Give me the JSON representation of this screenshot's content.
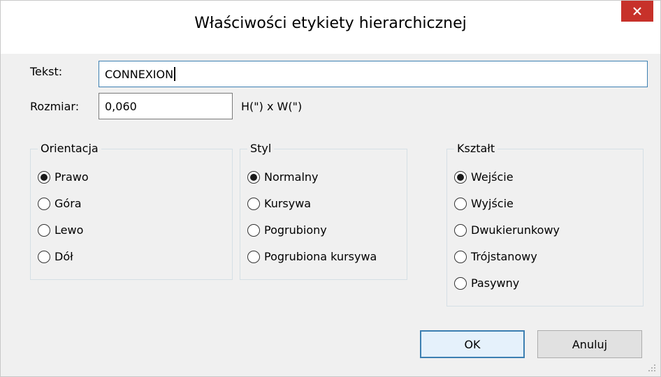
{
  "window": {
    "title": "Właściwości etykiety hierarchicznej",
    "close_glyph": "✕"
  },
  "form": {
    "text_label": "Tekst:",
    "text_value": "CONNEXION",
    "size_label": "Rozmiar:",
    "size_value": "0,060",
    "size_unit": "H(\") x W(\")"
  },
  "groups": {
    "orientation": {
      "title": "Orientacja",
      "options": [
        "Prawo",
        "Góra",
        "Lewo",
        "Dół"
      ],
      "selected": 0
    },
    "style": {
      "title": "Styl",
      "options": [
        "Normalny",
        "Kursywa",
        "Pogrubiony",
        "Pogrubiona kursywa"
      ],
      "selected": 0
    },
    "shape": {
      "title": "Kształt",
      "options": [
        "Wejście",
        "Wyjście",
        "Dwukierunkowy",
        "Trójstanowy",
        "Pasywny"
      ],
      "selected": 0
    }
  },
  "buttons": {
    "ok": "OK",
    "cancel": "Anuluj"
  },
  "colors": {
    "close_bg": "#c7312a",
    "focus_border": "#3c7fb1"
  }
}
